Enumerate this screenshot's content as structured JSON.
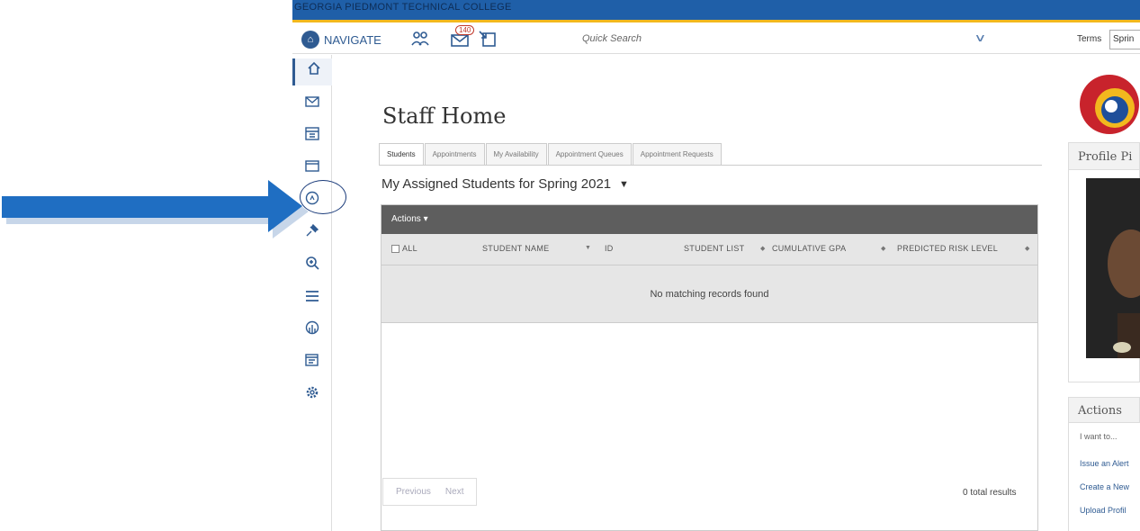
{
  "college_name": "GEORGIA PIEDMONT TECHNICAL COLLEGE",
  "header": {
    "nav_label": "NAVIGATE",
    "message_count": "140",
    "quick_search_placeholder": "Quick Search",
    "terms_label": "Terms",
    "terms_value": "Sprin"
  },
  "sidebar": [
    "home-icon",
    "mail-icon",
    "calendar-icon",
    "cases-icon",
    "reports-icon",
    "pin-icon",
    "search-icon",
    "list-icon",
    "analytics-icon",
    "calendar-list-icon",
    "settings-icon"
  ],
  "page": {
    "title": "Staff Home",
    "tabs": [
      "Students",
      "Appointments",
      "My Availability",
      "Appointment Queues",
      "Appointment Requests"
    ],
    "section_title": "My Assigned Students for Spring 2021",
    "actions_label": "Actions",
    "columns": {
      "all": "ALL",
      "student_name": "STUDENT NAME",
      "id": "ID",
      "student_list": "STUDENT LIST",
      "gpa": "CUMULATIVE GPA",
      "risk": "PREDICTED RISK LEVEL"
    },
    "no_records": "No matching records found",
    "pager": {
      "previous": "Previous",
      "next": "Next"
    },
    "total_results": "0 total results"
  },
  "right_panel": {
    "profile_title": "Profile Pi",
    "actions_title": "Actions",
    "i_want_to": "I want to...",
    "links": [
      "Issue an Alert",
      "Create a New",
      "Upload Profil"
    ]
  },
  "colors": {
    "brand_blue": "#2f5b92",
    "college_bar": "#1f5fa8",
    "college_stripe": "#f2b81e",
    "arrow": "#1f6ec2",
    "link": "#2f5b92"
  }
}
